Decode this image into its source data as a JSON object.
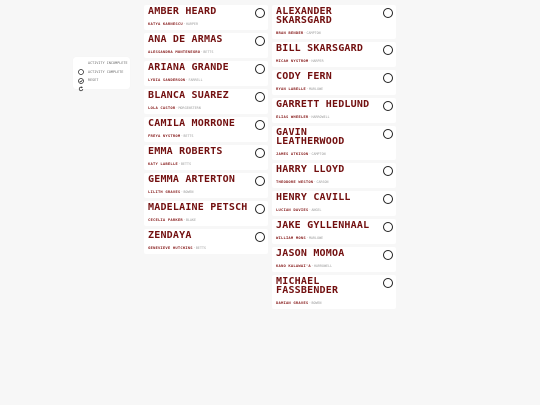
{
  "legend": {
    "incomplete": "ACTIVITY INCOMPLETE",
    "complete": "ACTIVITY COMPLETE",
    "reset": "RESET"
  },
  "left": [
    {
      "name": "AMBER HEARD",
      "student": "KATYA KARNESCU",
      "house": "HARPER"
    },
    {
      "name": "ANA DE ARMAS",
      "student": "ALESSANDRA MONTENEGRO",
      "house": "BETTS"
    },
    {
      "name": "ARIANA GRANDE",
      "student": "LYDIA SANDERSON",
      "house": "FARRELL"
    },
    {
      "name": "BLANCA SUAREZ",
      "student": "LOLA CASTOR",
      "house": "MORGENSTERN"
    },
    {
      "name": "CAMILA MORRONE",
      "student": "FREYA NYSTROM",
      "house": "BETTS"
    },
    {
      "name": "EMMA ROBERTS",
      "student": "KATY LABELLE",
      "house": "BETTS"
    },
    {
      "name": "GEMMA ARTERTON",
      "student": "LILITH GRAVES",
      "house": "BOWEN"
    },
    {
      "name": "MADELAINE PETSCH",
      "student": "CECELIA PARKER",
      "house": "BLAKE"
    },
    {
      "name": "ZENDAYA",
      "student": "GENEVIEVE HUTCHINS",
      "house": "BETTS"
    }
  ],
  "right": [
    {
      "name": "ALEXANDER SKARSGARD",
      "student": "BRAN BENDER",
      "house": "CAMPTON"
    },
    {
      "name": "BILL SKARSGARD",
      "student": "MICAH NYSTROM",
      "house": "HARPER"
    },
    {
      "name": "CODY FERN",
      "student": "RYAN LABELLE",
      "house": "MARLOWE"
    },
    {
      "name": "GARRETT HEDLUND",
      "student": "ELIAS WHEELER",
      "house": "HARROWELL"
    },
    {
      "name": "GAVIN LEATHERWOOD",
      "student": "JAMES ATKISON",
      "house": "CAMPTON"
    },
    {
      "name": "HARRY LLOYD",
      "student": "THEODORE WESTON",
      "house": "CARSON"
    },
    {
      "name": "HENRY CAVILL",
      "student": "LUCIAN DAVIES",
      "house": "ANGEL"
    },
    {
      "name": "JAKE GYLLENHAAL",
      "student": "WILLIAM MONS",
      "house": "MARLOWE"
    },
    {
      "name": "JASON MOMOA",
      "student": "KANO KALAWAI'A",
      "house": "HARROWELL"
    },
    {
      "name": "MICHAEL FASSBENDER",
      "student": "DAMIAN GRAVES",
      "house": "BOWEN"
    }
  ]
}
